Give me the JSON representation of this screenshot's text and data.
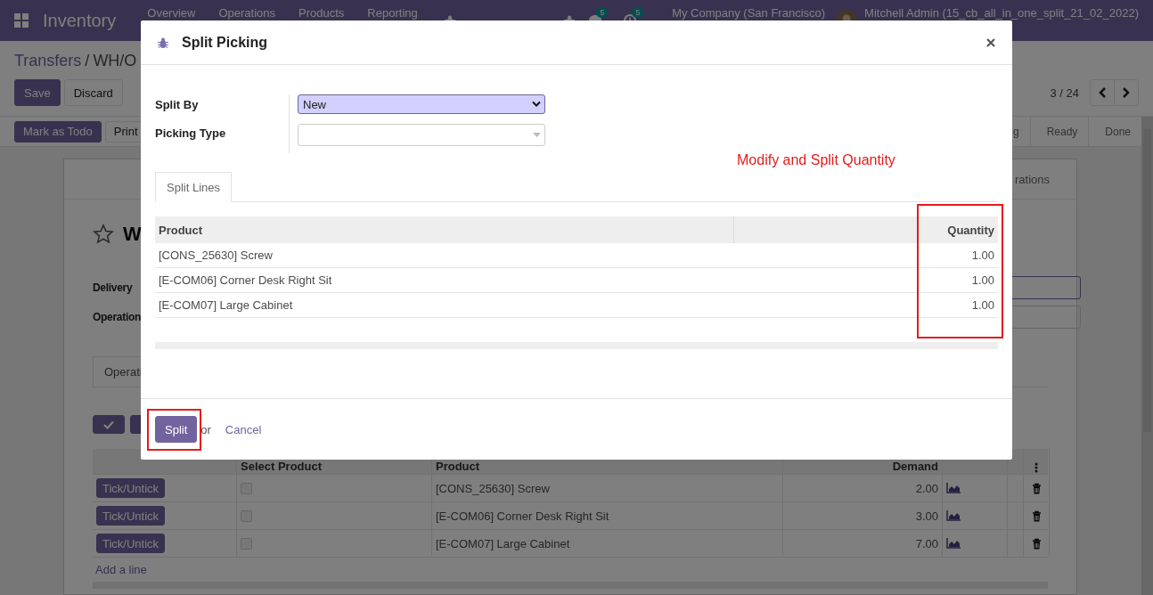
{
  "navbar": {
    "app_name": "Inventory",
    "menu": [
      "Overview",
      "Operations",
      "Products",
      "Reporting"
    ],
    "messages_badge": "5",
    "activities_badge": "5",
    "company": "My Company (San Francisco)",
    "user": "Mitchell Admin (15_cb_all_in_one_split_21_02_2022)"
  },
  "breadcrumb": {
    "parent": "Transfers",
    "separator": "/",
    "current": "WH/O"
  },
  "form_buttons": [
    {
      "label": "Save",
      "kind": "primary"
    },
    {
      "label": "Discard",
      "kind": "secondary"
    }
  ],
  "pager": "3 / 24",
  "actions": [
    {
      "label": "Mark as Todo",
      "kind": "primary"
    },
    {
      "label": "Print",
      "kind": "secondary"
    }
  ],
  "status_stages": [
    "g",
    "Ready",
    "Done"
  ],
  "sheet": {
    "smart_button": "rations",
    "starred": false,
    "title": "W",
    "fields": [
      "Delivery",
      "Operation"
    ],
    "tab": "Operati",
    "lines": {
      "columns": [
        "Select Product",
        "Product",
        "Demand"
      ],
      "rows": [
        {
          "action": "Tick/Untick",
          "checked": false,
          "product": "[CONS_25630] Screw",
          "demand": "2.00"
        },
        {
          "action": "Tick/Untick",
          "checked": false,
          "product": "[E-COM06] Corner Desk Right Sit",
          "demand": "3.00"
        },
        {
          "action": "Tick/Untick",
          "checked": false,
          "product": "[E-COM07] Large Cabinet",
          "demand": "7.00"
        }
      ],
      "add_line": "Add a line"
    }
  },
  "dialog": {
    "title": "Split Picking",
    "fields": [
      {
        "label": "Split By",
        "kind": "select",
        "value": "New"
      },
      {
        "label": "Picking Type",
        "kind": "many2one"
      }
    ],
    "annotation": "Modify and Split Quantity",
    "tabs": [
      {
        "label": "Split Lines",
        "selected": true
      }
    ],
    "table": {
      "columns": [
        "Product",
        "Quantity"
      ],
      "quantity_highlighted": true,
      "rows": [
        {
          "product": "[CONS_25630] Screw",
          "quantity": "1.00"
        },
        {
          "product": "[E-COM06] Corner Desk Right Sit",
          "quantity": "1.00"
        },
        {
          "product": "[E-COM07] Large Cabinet",
          "quantity": "1.00"
        }
      ]
    },
    "buttons": [
      {
        "label": "Split",
        "kind": "primary",
        "highlighted": true
      },
      {
        "label": "or",
        "kind": "text"
      },
      {
        "label": "Cancel",
        "kind": "link"
      }
    ]
  }
}
